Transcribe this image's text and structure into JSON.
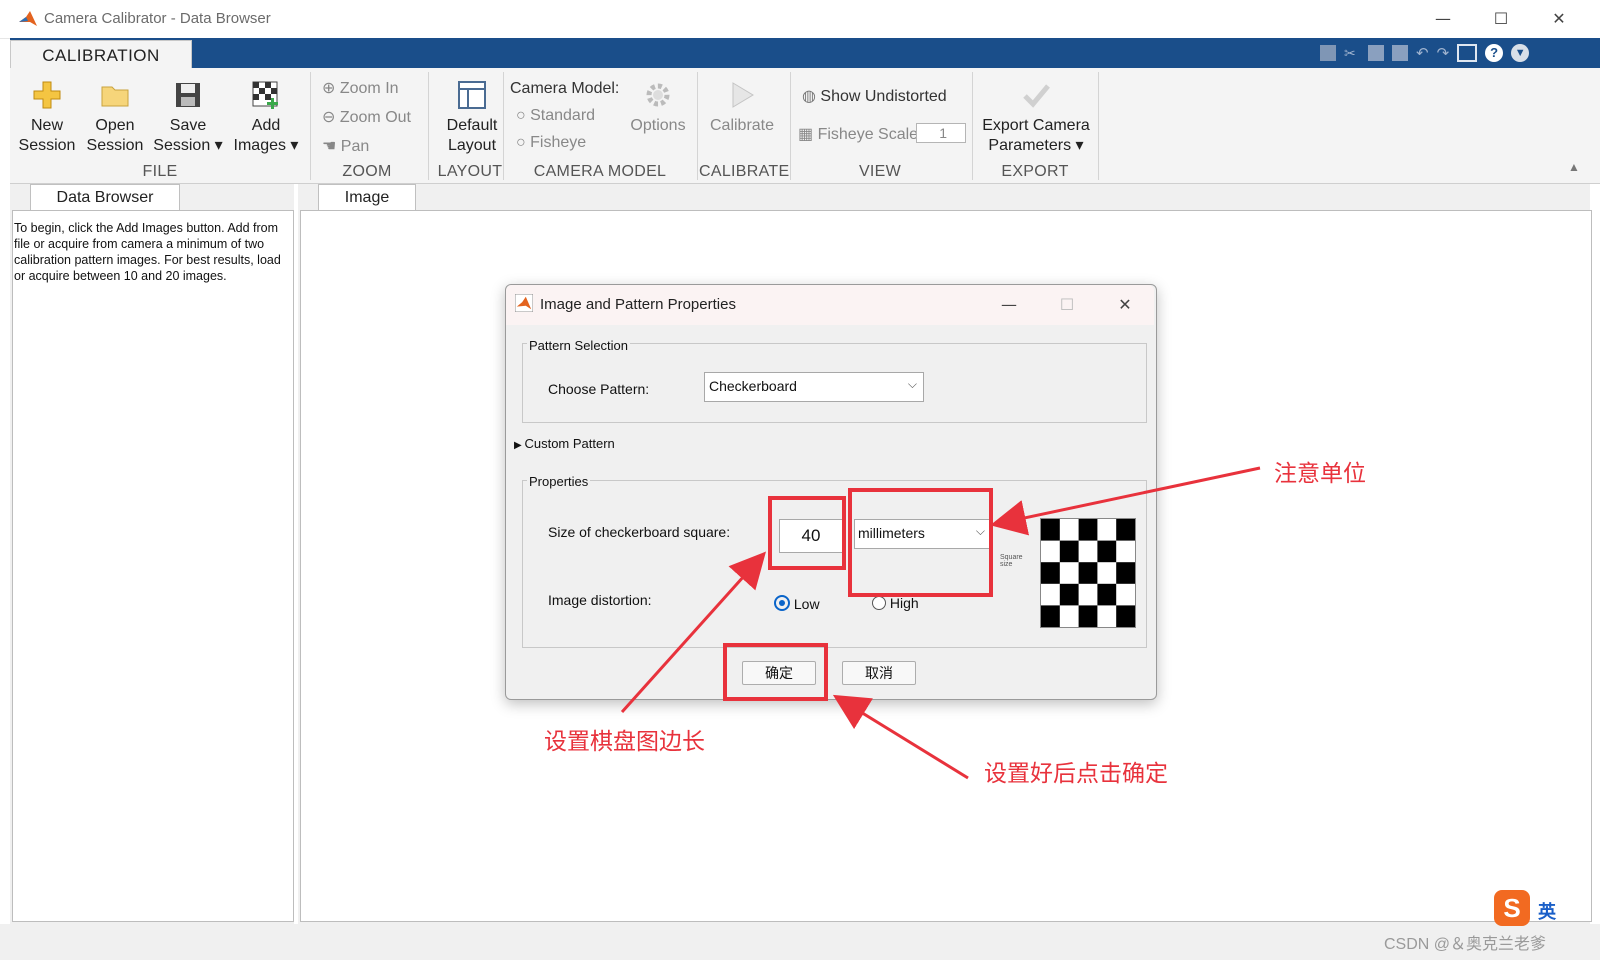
{
  "window": {
    "title": "Camera Calibrator - Data Browser",
    "minimize": "—",
    "maximize": "☐",
    "close": "✕"
  },
  "ribbon": {
    "tab": "CALIBRATION",
    "file": {
      "section": "FILE",
      "new_l1": "New",
      "new_l2": "Session",
      "open_l1": "Open",
      "open_l2": "Session",
      "save_l1": "Save",
      "save_l2": "Session ▾",
      "add_l1": "Add",
      "add_l2": "Images ▾"
    },
    "zoom": {
      "section": "ZOOM",
      "zoom_in": "Zoom In",
      "zoom_out": "Zoom Out",
      "pan": "Pan"
    },
    "layout": {
      "section": "LAYOUT",
      "l1": "Default",
      "l2": "Layout"
    },
    "camera_model": {
      "section": "CAMERA MODEL",
      "title": "Camera Model:",
      "standard": "Standard",
      "fisheye": "Fisheye",
      "options": "Options"
    },
    "calibrate": {
      "section": "CALIBRATE",
      "label": "Calibrate"
    },
    "view": {
      "section": "VIEW",
      "show_undistorted": "Show Undistorted",
      "fisheye_scale": "Fisheye Scale",
      "scale_value": "1"
    },
    "export": {
      "section": "EXPORT",
      "l1": "Export Camera",
      "l2": "Parameters ▾"
    }
  },
  "left_panel": {
    "tab": "Data Browser",
    "info": "To begin, click the Add Images button. Add from file or acquire from camera a minimum of two calibration pattern images. For best results, load or acquire between 10 and 20 images."
  },
  "right_panel": {
    "tab": "Image"
  },
  "dialog": {
    "title": "Image and Pattern Properties",
    "pattern_group": "Pattern Selection",
    "choose_pattern_label": "Choose Pattern:",
    "pattern_value": "Checkerboard",
    "custom_pattern": "Custom Pattern",
    "properties_group": "Properties",
    "size_label": "Size of checkerboard square:",
    "size_value": "40",
    "unit_value": "millimeters",
    "distortion_label": "Image distortion:",
    "low": "Low",
    "high": "High",
    "distortion_selected": "Low",
    "square_size_caption": "Square size",
    "ok": "确定",
    "cancel": "取消"
  },
  "annotations": {
    "units_note": "注意单位",
    "size_note": "设置棋盘图边长",
    "confirm_note": "设置好后点击确定",
    "accent_color": "#e8323c"
  },
  "watermark": {
    "text": "CSDN @＆奥克兰老爹",
    "ime": "英"
  }
}
